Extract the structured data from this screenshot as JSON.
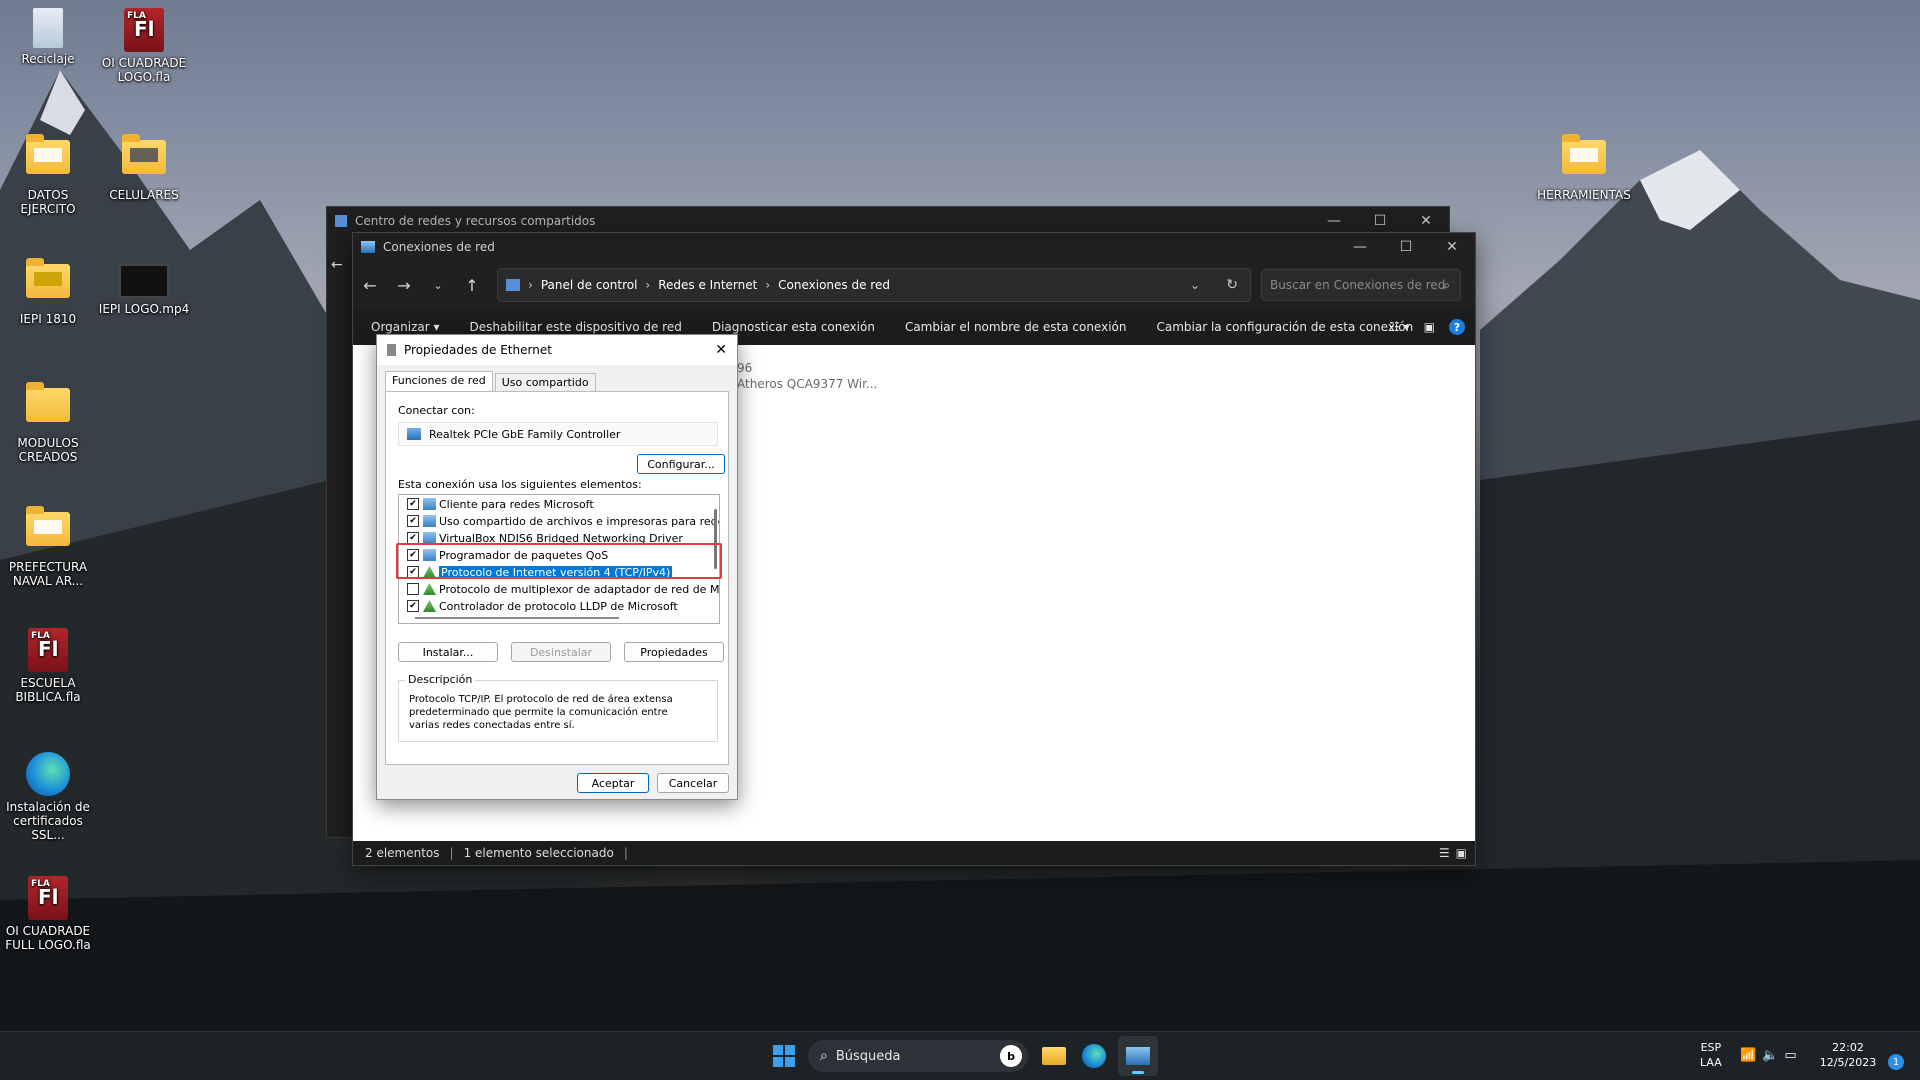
{
  "desktop": {
    "icons": [
      {
        "label": "Reciclaje",
        "kind": "recycle"
      },
      {
        "label": "OI CUADRADE LOGO.fla",
        "kind": "fla"
      },
      {
        "label": "DATOS EJERCITO",
        "kind": "folder"
      },
      {
        "label": "CELULARES",
        "kind": "folder"
      },
      {
        "label": "IEPI 1810",
        "kind": "folder"
      },
      {
        "label": "IEPI LOGO.mp4",
        "kind": "video"
      },
      {
        "label": "MODULOS CREADOS",
        "kind": "folder"
      },
      {
        "label": "PREFECTURA NAVAL AR...",
        "kind": "folder"
      },
      {
        "label": "ESCUELA BIBLICA.fla",
        "kind": "fla"
      },
      {
        "label": "Instalación de certificados SSL...",
        "kind": "edge"
      },
      {
        "label": "OI CUADRADE FULL LOGO.fla",
        "kind": "fla"
      },
      {
        "label": "HERRAMIENTAS",
        "kind": "folder"
      }
    ],
    "fla_badge": "FLA",
    "fla_glyph": "Fl"
  },
  "back_window": {
    "title": "Centro de redes y recursos compartidos"
  },
  "explorer": {
    "title": "Conexiones de red",
    "breadcrumb": [
      "Panel de control",
      "Redes e Internet",
      "Conexiones de red"
    ],
    "search_placeholder": "Buscar en Conexiones de red",
    "commands": [
      "Organizar ▾",
      "Deshabilitar este dispositivo de red",
      "Diagnosticar esta conexión",
      "Cambiar el nombre de esta conexión",
      "Cambiar la configuración de esta conexión"
    ],
    "content_fragments": [
      "96",
      "Atheros QCA9377 Wir..."
    ],
    "status": {
      "items": "2 elementos",
      "selected": "1 elemento seleccionado"
    }
  },
  "dialog": {
    "title": "Propiedades de Ethernet",
    "tabs": [
      "Funciones de red",
      "Uso compartido"
    ],
    "connect_with_label": "Conectar con:",
    "adapter": "Realtek PCIe GbE Family Controller",
    "configure_button": "Configurar...",
    "items_label": "Esta conexión usa los siguientes elementos:",
    "items": [
      {
        "label": "Cliente para redes Microsoft",
        "checked": true,
        "icon": "net"
      },
      {
        "label": "Uso compartido de archivos e impresoras para redes M",
        "checked": true,
        "icon": "net"
      },
      {
        "label": "VirtualBox NDIS6 Bridged Networking Driver",
        "checked": true,
        "icon": "net"
      },
      {
        "label": "Programador de paquetes QoS",
        "checked": true,
        "icon": "net"
      },
      {
        "label": "Protocolo de Internet versión 4 (TCP/IPv4)",
        "checked": true,
        "icon": "proto",
        "selected": true
      },
      {
        "label": "Protocolo de multiplexor de adaptador de red de Micros",
        "checked": false,
        "icon": "proto"
      },
      {
        "label": "Controlador de protocolo LLDP de Microsoft",
        "checked": true,
        "icon": "proto"
      }
    ],
    "install_button": "Instalar...",
    "uninstall_button": "Desinstalar",
    "properties_button": "Propiedades",
    "description_caption": "Descripción",
    "description_text": "Protocolo TCP/IP. El protocolo de red de área extensa predeterminado que permite la comunicación entre varias redes conectadas entre sí.",
    "ok_button": "Aceptar",
    "cancel_button": "Cancelar"
  },
  "taskbar": {
    "search_label": "Búsqueda",
    "language": "ESP",
    "layout": "LAA",
    "time": "22:02",
    "date": "12/5/2023",
    "notifications": "1"
  },
  "colors": {
    "highlight": "#e23b3b",
    "selection": "#0078d7",
    "help": "#1a7fe0"
  }
}
